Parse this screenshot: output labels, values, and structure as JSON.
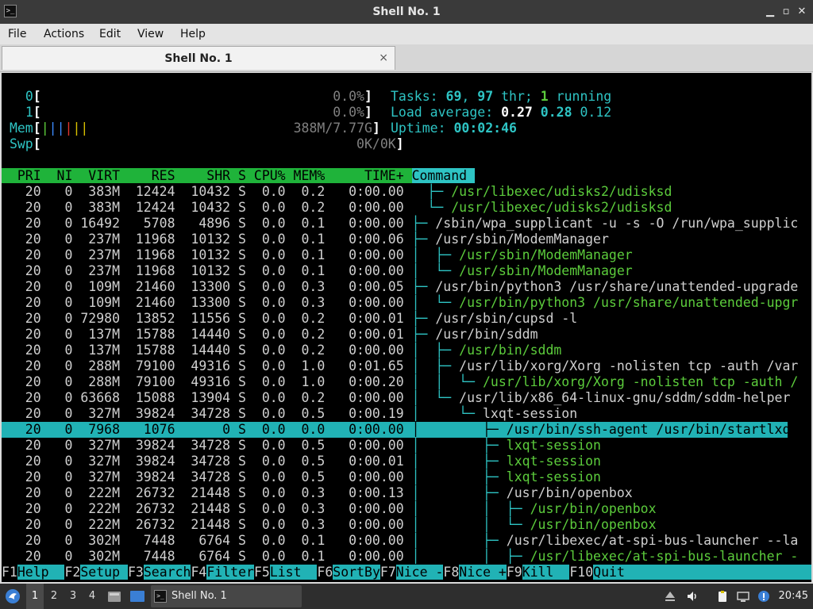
{
  "window": {
    "title": "Shell No. 1",
    "minimize": "▁",
    "maximize": "▫",
    "close": "✕"
  },
  "menu": [
    "File",
    "Actions",
    "Edit",
    "View",
    "Help"
  ],
  "tab": {
    "label": "Shell No. 1",
    "close": "×"
  },
  "htop": {
    "meters": {
      "cpu0": {
        "label": "0",
        "value": "0.0%"
      },
      "cpu1": {
        "label": "1",
        "value": "0.0%"
      },
      "mem": {
        "label": "Mem",
        "value": "388M/7.77G"
      },
      "swp": {
        "label": "Swp",
        "value": "0K/0K"
      }
    },
    "tasks": {
      "label": "Tasks:",
      "total": "69",
      "threads": "97",
      "thr_label": "thr;",
      "running": "1",
      "running_label": "running"
    },
    "load": {
      "label": "Load average:",
      "one": "0.27",
      "five": "0.28",
      "fifteen": "0.12"
    },
    "uptime": {
      "label": "Uptime:",
      "value": "00:02:46"
    },
    "columns": [
      "PRI",
      "NI",
      "VIRT",
      "RES",
      "SHR",
      "S",
      "CPU%",
      "MEM%",
      "TIME+",
      "Command"
    ],
    "rows": [
      {
        "pri": "20",
        "ni": "0",
        "virt": "383M",
        "res": "12424",
        "shr": "10432",
        "s": "S",
        "cpu": "0.0",
        "mem": "0.2",
        "time": "0:00.00",
        "tree": "  ├─ ",
        "cmd": "/usr/libexec/udisks2/udisksd",
        "thread": true
      },
      {
        "pri": "20",
        "ni": "0",
        "virt": "383M",
        "res": "12424",
        "shr": "10432",
        "s": "S",
        "cpu": "0.0",
        "mem": "0.2",
        "time": "0:00.00",
        "tree": "  └─ ",
        "cmd": "/usr/libexec/udisks2/udisksd",
        "thread": true
      },
      {
        "pri": "20",
        "ni": "0",
        "virt": "16492",
        "res": "5708",
        "shr": "4896",
        "s": "S",
        "cpu": "0.0",
        "mem": "0.1",
        "time": "0:00.00",
        "tree": "├─ ",
        "cmd": "/sbin/wpa_supplicant -u -s -O /run/wpa_supplic",
        "thread": false
      },
      {
        "pri": "20",
        "ni": "0",
        "virt": "237M",
        "res": "11968",
        "shr": "10132",
        "s": "S",
        "cpu": "0.0",
        "mem": "0.1",
        "time": "0:00.06",
        "tree": "├─ ",
        "cmd": "/usr/sbin/ModemManager",
        "thread": false
      },
      {
        "pri": "20",
        "ni": "0",
        "virt": "237M",
        "res": "11968",
        "shr": "10132",
        "s": "S",
        "cpu": "0.0",
        "mem": "0.1",
        "time": "0:00.00",
        "tree": "│  ├─ ",
        "cmd": "/usr/sbin/ModemManager",
        "thread": true
      },
      {
        "pri": "20",
        "ni": "0",
        "virt": "237M",
        "res": "11968",
        "shr": "10132",
        "s": "S",
        "cpu": "0.0",
        "mem": "0.1",
        "time": "0:00.00",
        "tree": "│  └─ ",
        "cmd": "/usr/sbin/ModemManager",
        "thread": true
      },
      {
        "pri": "20",
        "ni": "0",
        "virt": "109M",
        "res": "21460",
        "shr": "13300",
        "s": "S",
        "cpu": "0.0",
        "mem": "0.3",
        "time": "0:00.05",
        "tree": "├─ ",
        "cmd": "/usr/bin/python3 /usr/share/unattended-upgrade",
        "thread": false
      },
      {
        "pri": "20",
        "ni": "0",
        "virt": "109M",
        "res": "21460",
        "shr": "13300",
        "s": "S",
        "cpu": "0.0",
        "mem": "0.3",
        "time": "0:00.00",
        "tree": "│  └─ ",
        "cmd": "/usr/bin/python3 /usr/share/unattended-upgr",
        "thread": true
      },
      {
        "pri": "20",
        "ni": "0",
        "virt": "72980",
        "res": "13852",
        "shr": "11556",
        "s": "S",
        "cpu": "0.0",
        "mem": "0.2",
        "time": "0:00.01",
        "tree": "├─ ",
        "cmd": "/usr/sbin/cupsd -l",
        "thread": false
      },
      {
        "pri": "20",
        "ni": "0",
        "virt": "137M",
        "res": "15788",
        "shr": "14440",
        "s": "S",
        "cpu": "0.0",
        "mem": "0.2",
        "time": "0:00.01",
        "tree": "├─ ",
        "cmd": "/usr/bin/sddm",
        "thread": false
      },
      {
        "pri": "20",
        "ni": "0",
        "virt": "137M",
        "res": "15788",
        "shr": "14440",
        "s": "S",
        "cpu": "0.0",
        "mem": "0.2",
        "time": "0:00.00",
        "tree": "│  ├─ ",
        "cmd": "/usr/bin/sddm",
        "thread": true
      },
      {
        "pri": "20",
        "ni": "0",
        "virt": "288M",
        "res": "79100",
        "shr": "49316",
        "s": "S",
        "cpu": "0.0",
        "mem": "1.0",
        "time": "0:01.65",
        "tree": "│  ├─ ",
        "cmd": "/usr/lib/xorg/Xorg -nolisten tcp -auth /var",
        "thread": false
      },
      {
        "pri": "20",
        "ni": "0",
        "virt": "288M",
        "res": "79100",
        "shr": "49316",
        "s": "S",
        "cpu": "0.0",
        "mem": "1.0",
        "time": "0:00.20",
        "tree": "│  │  └─ ",
        "cmd": "/usr/lib/xorg/Xorg -nolisten tcp -auth /",
        "thread": true
      },
      {
        "pri": "20",
        "ni": "0",
        "virt": "63668",
        "res": "15088",
        "shr": "13904",
        "s": "S",
        "cpu": "0.0",
        "mem": "0.2",
        "time": "0:00.00",
        "tree": "│  └─ ",
        "cmd": "/usr/lib/x86_64-linux-gnu/sddm/sddm-helper",
        "thread": false
      },
      {
        "pri": "20",
        "ni": "0",
        "virt": "327M",
        "res": "39824",
        "shr": "34728",
        "s": "S",
        "cpu": "0.0",
        "mem": "0.5",
        "time": "0:00.19",
        "tree": "│     └─ ",
        "cmd": "lxqt-session",
        "thread": false
      },
      {
        "pri": "20",
        "ni": "0",
        "virt": "7968",
        "res": "1076",
        "shr": "0",
        "s": "S",
        "cpu": "0.0",
        "mem": "0.0",
        "time": "0:00.00",
        "tree": "│        ├─ ",
        "cmd": "/usr/bin/ssh-agent /usr/bin/startlxqt",
        "thread": false,
        "selected": true
      },
      {
        "pri": "20",
        "ni": "0",
        "virt": "327M",
        "res": "39824",
        "shr": "34728",
        "s": "S",
        "cpu": "0.0",
        "mem": "0.5",
        "time": "0:00.00",
        "tree": "│        ├─ ",
        "cmd": "lxqt-session",
        "thread": true
      },
      {
        "pri": "20",
        "ni": "0",
        "virt": "327M",
        "res": "39824",
        "shr": "34728",
        "s": "S",
        "cpu": "0.0",
        "mem": "0.5",
        "time": "0:00.01",
        "tree": "│        ├─ ",
        "cmd": "lxqt-session",
        "thread": true
      },
      {
        "pri": "20",
        "ni": "0",
        "virt": "327M",
        "res": "39824",
        "shr": "34728",
        "s": "S",
        "cpu": "0.0",
        "mem": "0.5",
        "time": "0:00.00",
        "tree": "│        ├─ ",
        "cmd": "lxqt-session",
        "thread": true
      },
      {
        "pri": "20",
        "ni": "0",
        "virt": "222M",
        "res": "26732",
        "shr": "21448",
        "s": "S",
        "cpu": "0.0",
        "mem": "0.3",
        "time": "0:00.13",
        "tree": "│        ├─ ",
        "cmd": "/usr/bin/openbox",
        "thread": false
      },
      {
        "pri": "20",
        "ni": "0",
        "virt": "222M",
        "res": "26732",
        "shr": "21448",
        "s": "S",
        "cpu": "0.0",
        "mem": "0.3",
        "time": "0:00.00",
        "tree": "│        │  ├─ ",
        "cmd": "/usr/bin/openbox",
        "thread": true
      },
      {
        "pri": "20",
        "ni": "0",
        "virt": "222M",
        "res": "26732",
        "shr": "21448",
        "s": "S",
        "cpu": "0.0",
        "mem": "0.3",
        "time": "0:00.00",
        "tree": "│        │  └─ ",
        "cmd": "/usr/bin/openbox",
        "thread": true
      },
      {
        "pri": "20",
        "ni": "0",
        "virt": "302M",
        "res": "7448",
        "shr": "6764",
        "s": "S",
        "cpu": "0.0",
        "mem": "0.1",
        "time": "0:00.00",
        "tree": "│        ├─ ",
        "cmd": "/usr/libexec/at-spi-bus-launcher --la",
        "thread": false
      },
      {
        "pri": "20",
        "ni": "0",
        "virt": "302M",
        "res": "7448",
        "shr": "6764",
        "s": "S",
        "cpu": "0.0",
        "mem": "0.1",
        "time": "0:00.00",
        "tree": "│        │  ├─ ",
        "cmd": "/usr/libexec/at-spi-bus-launcher -",
        "thread": true
      }
    ],
    "fkeys": [
      {
        "key": "F1",
        "label": "Help  "
      },
      {
        "key": "F2",
        "label": "Setup "
      },
      {
        "key": "F3",
        "label": "Search"
      },
      {
        "key": "F4",
        "label": "Filter"
      },
      {
        "key": "F5",
        "label": "List  "
      },
      {
        "key": "F6",
        "label": "SortBy"
      },
      {
        "key": "F7",
        "label": "Nice -"
      },
      {
        "key": "F8",
        "label": "Nice +"
      },
      {
        "key": "F9",
        "label": "Kill  "
      },
      {
        "key": "F10",
        "label": "Quit  "
      }
    ]
  },
  "taskbar": {
    "workspaces": [
      "1",
      "2",
      "3",
      "4"
    ],
    "active_workspace": "1",
    "task_label": "Shell No. 1",
    "clock": "20:45"
  },
  "colors": {
    "header_green": "#1fb33a",
    "selection_cyan": "#21b2b5",
    "cyan": "#2ec4c4",
    "thread_green": "#5ccc3c"
  }
}
